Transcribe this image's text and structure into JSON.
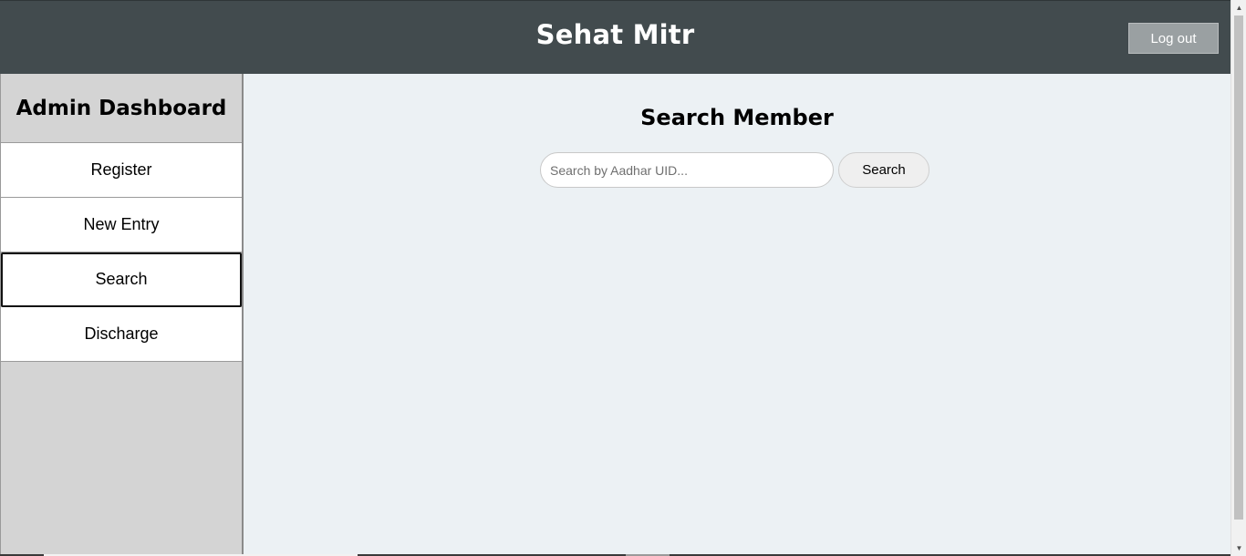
{
  "header": {
    "app_title": "Sehat Mitr",
    "logout_label": "Log out"
  },
  "sidebar": {
    "title": "Admin Dashboard",
    "items": [
      {
        "label": "Register",
        "active": false
      },
      {
        "label": "New Entry",
        "active": false
      },
      {
        "label": "Search",
        "active": true
      },
      {
        "label": "Discharge",
        "active": false
      }
    ]
  },
  "main": {
    "title": "Search Member",
    "search": {
      "placeholder": "Search by Aadhar UID...",
      "value": "",
      "button_label": "Search"
    }
  },
  "scrollbar": {
    "up_icon": "▲",
    "down_icon": "▼"
  },
  "colors": {
    "header_bg": "#424b4e",
    "sidebar_bg": "#d4d4d4",
    "main_bg": "#ecf1f4",
    "logout_bg": "#9aa0a2"
  }
}
